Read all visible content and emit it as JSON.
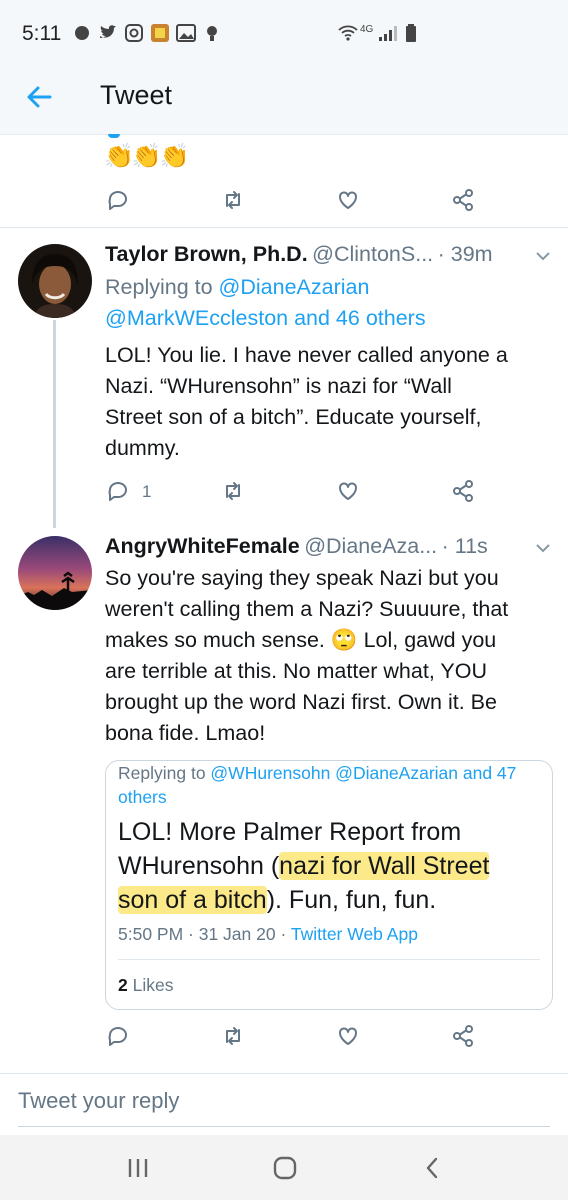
{
  "status_bar": {
    "time": "5:11",
    "network": "4G"
  },
  "header": {
    "title": "Tweet"
  },
  "top_tweet": {
    "emoji": "👏👏👏"
  },
  "tweet1": {
    "name": "Taylor Brown, Ph.D.",
    "handle": "@ClintonS...",
    "time": "· 39m",
    "replying_prefix": "Replying to ",
    "replying_line1": "@DianeAzarian",
    "replying_line2": "@MarkWEccleston and 46 others",
    "text_lines": [
      "LOL! You lie. I have never called anyone a",
      "Nazi.  “WHurensohn” is nazi for “Wall",
      "Street son of a bitch”. Educate yourself,",
      "dummy."
    ],
    "reply_count": "1"
  },
  "tweet2": {
    "name": "AngryWhiteFemale",
    "handle": "@DianeAza...",
    "time": "· 11s",
    "text_lines": [
      "So you're saying they speak Nazi but you",
      "weren't calling them a Nazi? Suuuure, that",
      "makes so much sense. 🙄 Lol, gawd you",
      "are terrible at this. No matter what, YOU",
      "brought up the word Nazi first. Own it. Be",
      "bona fide. Lmao!"
    ],
    "quote": {
      "replying_prefix": "Replying to ",
      "replying_handles": "@WHurensohn @DianeAzarian and 47",
      "replying_handles_2": "others",
      "line1": "LOL! More Palmer Report from",
      "line2_a": "WHurensohn (",
      "line2_b": "nazi for Wall Street",
      "line3_a": "son of a bitch",
      "line3_b": ").  Fun, fun, fun.",
      "timestamp": "5:50 PM · 31 Jan 20 · ",
      "source": "Twitter Web App",
      "likes_count": "2",
      "likes_label": " Likes"
    }
  },
  "reply_bar": {
    "placeholder": "Tweet your reply"
  },
  "colors": {
    "accent": "#1da1f2",
    "secondary_text": "#657786",
    "highlight": "#fbe98a"
  }
}
